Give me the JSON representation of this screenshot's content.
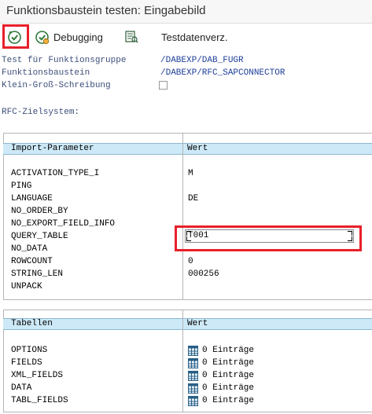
{
  "window": {
    "title": "Funktionsbaustein testen: Eingabebild"
  },
  "toolbar": {
    "execute_icon": "execute-icon",
    "debugging_label": "Debugging",
    "testdata_label": "Testdatenverz."
  },
  "header": {
    "fields": [
      {
        "label": "Test für Funktionsgruppe",
        "value": "/DABEXP/DAB_FUGR"
      },
      {
        "label": "Funktionsbaustein",
        "value": "/DABEXP/RFC_SAPCONNECTOR"
      }
    ],
    "case_label": "Klein-Groß-Schreibung",
    "case_checked": false,
    "rfc_label": "RFC-Zielsystem:",
    "rfc_value": ""
  },
  "import_table": {
    "col_name": "Import-Parameter",
    "col_value": "Wert",
    "rows": [
      {
        "name": "ACTIVATION_TYPE_I",
        "value": "M"
      },
      {
        "name": "PING",
        "value": ""
      },
      {
        "name": "LANGUAGE",
        "value": "DE"
      },
      {
        "name": "NO_ORDER_BY",
        "value": ""
      },
      {
        "name": "NO_EXPORT_FIELD_INFO",
        "value": ""
      },
      {
        "name": "QUERY_TABLE",
        "value": "T001"
      },
      {
        "name": "NO_DATA",
        "value": ""
      },
      {
        "name": "ROWCOUNT",
        "value": "0"
      },
      {
        "name": "STRING_LEN",
        "value": "000256"
      },
      {
        "name": "UNPACK",
        "value": ""
      }
    ]
  },
  "tables_table": {
    "col_name": "Tabellen",
    "col_value": "Wert",
    "rows": [
      {
        "name": "OPTIONS",
        "value": "0 Einträge"
      },
      {
        "name": "FIELDS",
        "value": "0 Einträge"
      },
      {
        "name": "XML_FIELDS",
        "value": "0 Einträge"
      },
      {
        "name": "DATA",
        "value": "0 Einträge"
      },
      {
        "name": "TABL_FIELDS",
        "value": "0 Einträge"
      }
    ]
  },
  "colors": {
    "highlight": "#e8202a",
    "table_header": "#cde9f7",
    "label_text": "#3d4f7a",
    "value_text": "#1e3f9a"
  }
}
